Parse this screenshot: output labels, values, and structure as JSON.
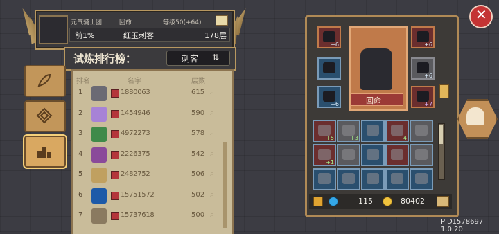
{
  "player": {
    "guild": "元气骑士团",
    "revive": "回命",
    "level": "等级50(+64)",
    "rank_pct": "前1%",
    "title": "红玉刺客",
    "floor": "178层"
  },
  "board": {
    "title": "试炼排行榜：",
    "class": "刺客",
    "columns": {
      "rank": "排名",
      "name": "名字",
      "floor": "层数"
    },
    "rows": [
      {
        "rank": "1",
        "name": "1880063",
        "floor": "615",
        "color": "#6b6a74"
      },
      {
        "rank": "2",
        "name": "1454946",
        "floor": "590",
        "color": "#a782d6"
      },
      {
        "rank": "3",
        "name": "4972273",
        "floor": "578",
        "color": "#3f8a49"
      },
      {
        "rank": "4",
        "name": "2226375",
        "floor": "542",
        "color": "#8a4a9a"
      },
      {
        "rank": "5",
        "name": "2482752",
        "floor": "506",
        "color": "#c0a060"
      },
      {
        "rank": "6",
        "name": "15751572",
        "floor": "502",
        "color": "#1d5aa8"
      },
      {
        "rank": "7",
        "name": "15737618",
        "floor": "500",
        "color": "#8a7a60"
      }
    ]
  },
  "equipment": {
    "revive_button": "回命",
    "slots": [
      {
        "name": "scarf-slot",
        "num": "+6"
      },
      {
        "name": "belt-slot",
        "num": ""
      },
      {
        "name": "boots-slot",
        "num": "+6"
      },
      {
        "name": "armor-slot",
        "num": "+6"
      },
      {
        "name": "gloves-slot",
        "num": "+6"
      },
      {
        "name": "weapon-slot",
        "num": "+7"
      }
    ],
    "inventory": [
      {
        "num": "+5"
      },
      {
        "num": "+3"
      },
      {
        "num": ""
      },
      {
        "num": "+4"
      },
      {
        "num": ""
      },
      {
        "num": "+1"
      },
      {
        "num": ""
      },
      {
        "num": ""
      },
      {
        "num": ""
      },
      {
        "num": ""
      },
      {
        "num": ""
      },
      {
        "num": ""
      },
      {
        "num": ""
      },
      {
        "num": ""
      },
      {
        "num": ""
      }
    ]
  },
  "currency": {
    "gems": "115",
    "coins": "80402"
  },
  "version": "PID1578697 1.0.20"
}
